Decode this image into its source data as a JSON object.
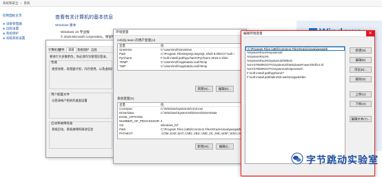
{
  "control_panel": {
    "breadcrumb": [
      "系统和安全",
      "系统"
    ],
    "nav": [
      "控制面板主页",
      "设备管理器",
      "远程设置",
      "系统保护",
      "高级系统设置"
    ],
    "heading": "查看有关计算机的基本信息",
    "edition_label": "Windows 版本",
    "edition": "Windows 10 专业版",
    "copyright": "© 2018 Microsoft Corporation。保留所有权利。",
    "logo_text": "Windows"
  },
  "system_properties": {
    "tabs": [
      "计算机名",
      "硬件",
      "高级",
      "系统保护",
      "远程"
    ],
    "active_tab": "高级",
    "admin_note": "要进行大多数更改，你必须作为管理员登录。",
    "perf_title": "性能",
    "perf_desc": "视觉效果，处理器计划，内存使用，以及虚拟内存",
    "profile_title": "用户配置文件",
    "profile_desc": "与登录帐户相关的桌面设置",
    "startup_title": "启动和故障恢复",
    "startup_desc": "系统启动、系统故障和调试信息"
  },
  "env_vars": {
    "title": "环境变量",
    "user_section": "mrli@j-team 的用户变量(U)",
    "header_var": "变量",
    "header_val": "值",
    "user_vars": [
      {
        "name": "OneDrive",
        "value": "C:\\Users\\mrli\\OneDrive"
      },
      {
        "name": "Path",
        "value": "C:\\Program Files\\MySQL\\MySQL Shell 8.0\\bin\\;F:\\soft i"
      },
      {
        "name": "PyCharm",
        "value": "F:\\soft install path\\pycharm\\PyCharm 2019.3.1\\bin;"
      },
      {
        "name": "TEMP",
        "value": "C:\\Users\\mrli\\AppData\\Local\\Temp"
      },
      {
        "name": "TMP",
        "value": "C:\\Users\\mrli\\AppData\\Local\\Temp"
      }
    ],
    "user_buttons": [
      "新建(N)...",
      "编辑(E)..."
    ],
    "system_section": "系统变量(S)",
    "system_vars": [
      {
        "name": "ComSpec",
        "value": "C:\\Windows\\system32\\cmd.exe"
      },
      {
        "name": "DriverData",
        "value": "C:\\Windows\\System32\\Drivers\\DriverData"
      },
      {
        "name": "EXSE_OPTIONS",
        "value": ""
      },
      {
        "name": "NUMBER_OF_PROCESSORS",
        "value": "4"
      },
      {
        "name": "OS",
        "value": "Windows_NT"
      },
      {
        "name": "Path",
        "value": "C:\\Program Files (x86)\\Common Files\\Oracle\\Java\\javapath"
      },
      {
        "name": "PATHEXT",
        "value": ".COM;.EXE;.BAT;.CMD;.VBS;.VBE;.JS;.JSE;.WSF;.WSH;.MSC"
      }
    ],
    "system_buttons": [
      "新建(W)...",
      "编辑(I)..."
    ]
  },
  "edit_env": {
    "title": "编辑环境变量",
    "entries": [
      "C:\\Program Files (x86)\\Common Files\\Oracle\\Java\\javapath",
      "%SystemRoot%\\system32",
      "%SystemRoot%",
      "%SystemRoot%\\System32\\Wbem",
      "%SYSTEMROOT%\\System32\\WindowsPowerShell\\v1.0\\",
      "%SYSTEMROOT%\\System32\\OpenSSH\\",
      "F:\\soft install path\\python27",
      "F:\\soft install path\\MinGW-w64\\mingw64\\bin"
    ],
    "buttons": [
      "新建(N)",
      "编辑(E)",
      "浏览(B)...",
      "删除(D)",
      "上移(U)",
      "下移(O)",
      "编辑文本(T)..."
    ]
  },
  "watermark": {
    "text": "字节跳动实验室"
  }
}
